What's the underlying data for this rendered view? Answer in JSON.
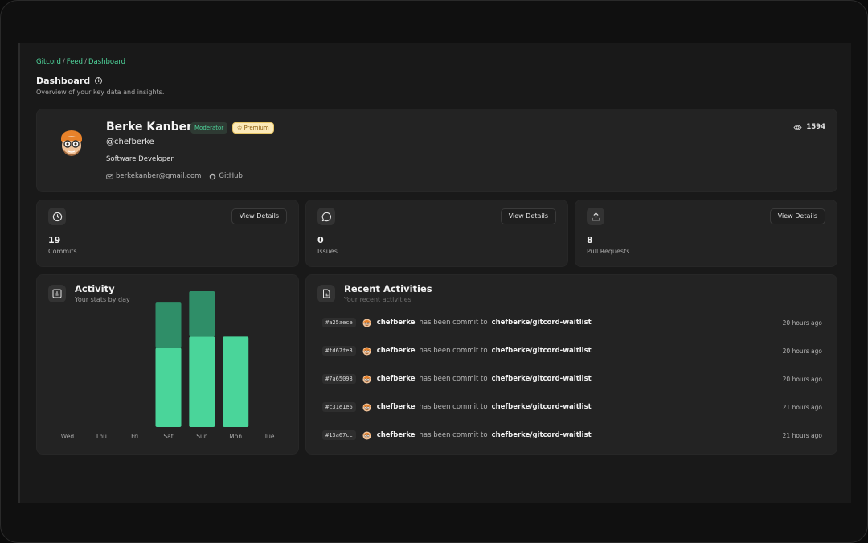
{
  "breadcrumb": [
    "Gitcord",
    "Feed",
    "Dashboard"
  ],
  "header": {
    "title": "Dashboard",
    "subtitle": "Overview of your key data and insights."
  },
  "profile": {
    "name": "Berke Kanber",
    "badge_moderator": "Moderator",
    "badge_premium": "Premium",
    "handle": "@chefberke",
    "role": "Software Developer",
    "email": "berkekanber@gmail.com",
    "github_label": "GitHub",
    "views": "1594"
  },
  "stats": [
    {
      "icon": "clock-icon",
      "value": "19",
      "label": "Commits",
      "button": "View Details"
    },
    {
      "icon": "message-circle-icon",
      "value": "0",
      "label": "Issues",
      "button": "View Details"
    },
    {
      "icon": "upload-icon",
      "value": "8",
      "label": "Pull Requests",
      "button": "View Details"
    }
  ],
  "activity": {
    "title": "Activity",
    "subtitle": "Your stats by day"
  },
  "chart_data": {
    "type": "bar",
    "categories": [
      "Wed",
      "Thu",
      "Fri",
      "Sat",
      "Sun",
      "Mon",
      "Tue"
    ],
    "series": [
      {
        "values": [
          0,
          0,
          0,
          7,
          8,
          8,
          0
        ]
      },
      {
        "values": [
          0,
          0,
          0,
          4,
          4,
          0,
          0
        ]
      }
    ],
    "stacked": true,
    "colors": [
      "#4ad59a",
      "#2f8e68"
    ],
    "grid": false,
    "ylim": [
      0,
      12
    ]
  },
  "recent": {
    "title": "Recent Activities",
    "subtitle": "Your recent activities",
    "items": [
      {
        "hash": "#a25aece",
        "user": "chefberke",
        "text": "has been commit to",
        "repo": "chefberke/gitcord-waitlist",
        "time": "20 hours ago"
      },
      {
        "hash": "#fd67fe3",
        "user": "chefberke",
        "text": "has been commit to",
        "repo": "chefberke/gitcord-waitlist",
        "time": "20 hours ago"
      },
      {
        "hash": "#7a65098",
        "user": "chefberke",
        "text": "has been commit to",
        "repo": "chefberke/gitcord-waitlist",
        "time": "20 hours ago"
      },
      {
        "hash": "#c31e1e6",
        "user": "chefberke",
        "text": "has been commit to",
        "repo": "chefberke/gitcord-waitlist",
        "time": "21 hours ago"
      },
      {
        "hash": "#13a67cc",
        "user": "chefberke",
        "text": "has been commit to",
        "repo": "chefberke/gitcord-waitlist",
        "time": "21 hours ago"
      }
    ]
  },
  "colors": {
    "accent": "#4fd69c",
    "card": "#232323",
    "background": "#191919"
  }
}
